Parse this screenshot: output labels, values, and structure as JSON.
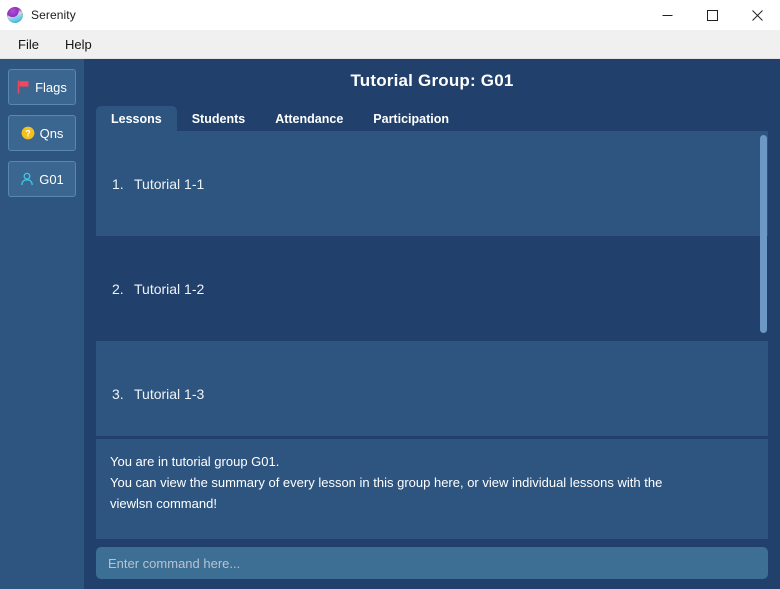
{
  "window": {
    "title": "Serenity",
    "logo_icon": "serenity-sphere-logo",
    "minimize_icon": "minimize-icon",
    "maximize_icon": "maximize-icon",
    "close_icon": "close-icon"
  },
  "menubar": {
    "items": [
      {
        "label": "File"
      },
      {
        "label": "Help"
      }
    ]
  },
  "sidebar": {
    "buttons": [
      {
        "label": "Flags",
        "icon": "flag-icon",
        "icon_color": "#e8485c"
      },
      {
        "label": "Qns",
        "icon": "question-circle-icon",
        "icon_color": "#f2c023"
      },
      {
        "label": "G01",
        "icon": "person-icon",
        "icon_color": "#43c6e0"
      }
    ]
  },
  "main": {
    "page_title": "Tutorial Group: G01",
    "tabs": [
      {
        "label": "Lessons",
        "active": true
      },
      {
        "label": "Students",
        "active": false
      },
      {
        "label": "Attendance",
        "active": false
      },
      {
        "label": "Participation",
        "active": false
      }
    ],
    "lessons": [
      {
        "number": "1.",
        "name": "Tutorial 1-1",
        "selected": true
      },
      {
        "number": "2.",
        "name": "Tutorial 1-2",
        "selected": false
      },
      {
        "number": "3.",
        "name": "Tutorial 1-3",
        "selected": true
      }
    ],
    "feedback": {
      "line1": "You are in tutorial group G01.",
      "line2": "You can view the summary of every lesson in this group here, or view individual lessons with the",
      "line3": "viewlsn command!"
    },
    "command": {
      "value": "",
      "placeholder": "Enter command here..."
    }
  },
  "colors": {
    "panel_dark": "#21406b",
    "panel_light": "#2d5580",
    "sidebar_button": "#3a6690",
    "input": "#3d6e94",
    "scrollbar_thumb": "#6d97c4",
    "titlebar": "#ffffff",
    "menubar": "#f0f0f0"
  }
}
